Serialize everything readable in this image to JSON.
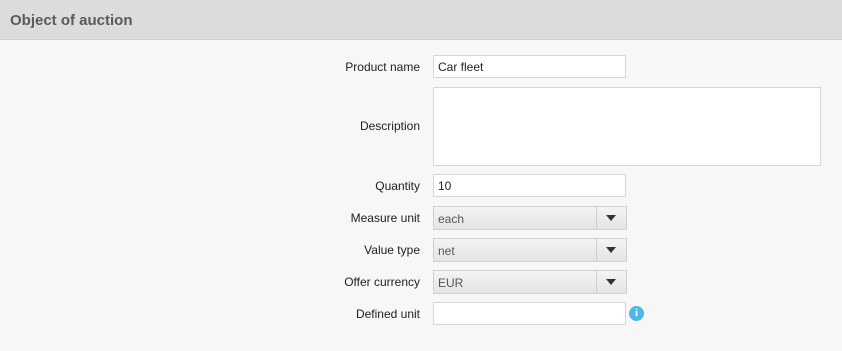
{
  "header": {
    "title": "Object of auction"
  },
  "form": {
    "product_name": {
      "label": "Product name",
      "value": "Car fleet"
    },
    "description": {
      "label": "Description",
      "value": ""
    },
    "quantity": {
      "label": "Quantity",
      "value": "10"
    },
    "measure_unit": {
      "label": "Measure unit",
      "value": "each"
    },
    "value_type": {
      "label": "Value type",
      "value": "net"
    },
    "offer_currency": {
      "label": "Offer currency",
      "value": "EUR"
    },
    "defined_unit": {
      "label": "Defined unit",
      "value": "",
      "info_glyph": "i"
    }
  },
  "colors": {
    "header_bg": "#dcdcdc",
    "page_bg": "#f7f7f7",
    "info_icon": "#4fb8e6"
  },
  "icons": {
    "dropdown": "chevron-down-icon",
    "info": "info-icon"
  }
}
